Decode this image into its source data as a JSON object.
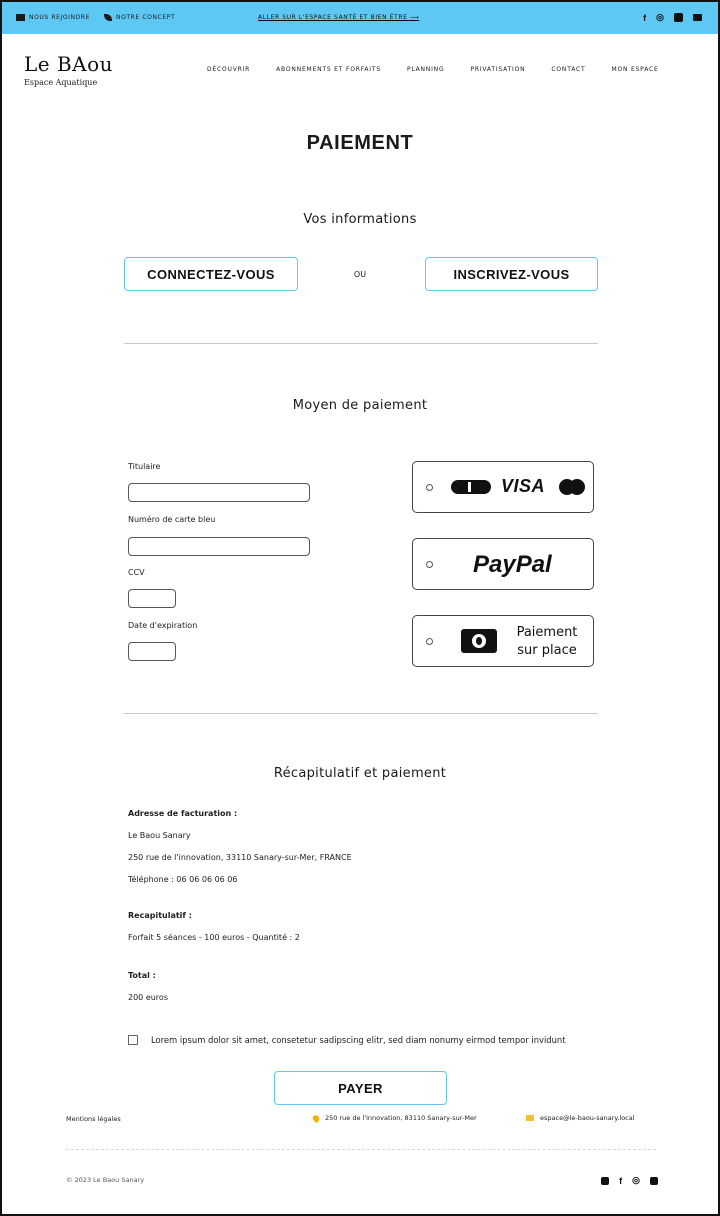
{
  "topbar": {
    "join": "NOUS REJOINDRE",
    "concept": "NOTRE CONCEPT",
    "health_link": "ALLER SUR L'ESPACE SANTÉ ET BIEN ÊTRE ⟶",
    "facebook": "f",
    "instagram": "◎"
  },
  "logo": {
    "main": "Le BAou",
    "sub": "Espace Aquatique"
  },
  "nav": [
    "DÉCOUVRIR",
    "ABONNEMENTS ET FORFAITS",
    "PLANNING",
    "PRIVATISATION",
    "CONTACT",
    "MON ESPACE"
  ],
  "page_title": "PAIEMENT",
  "info": {
    "heading": "Vos informations",
    "login": "CONNECTEZ-VOUS",
    "or": "OU",
    "signup": "INSCRIVEZ-VOUS"
  },
  "payment": {
    "heading": "Moyen de paiement",
    "holder_label": "Titulaire",
    "card_label": "Numéro de carte bleu",
    "ccv_label": "CCV",
    "expiry_label": "Date d'expiration",
    "visa": "VISA",
    "paypal": "PayPal",
    "onsite_line1": "Paiement",
    "onsite_line2": "sur place"
  },
  "summary": {
    "heading": "Récapitulatif et paiement",
    "billing_title": "Adresse de facturation :",
    "billing_name": "Le Baou Sanary",
    "billing_address": "250 rue de l'innovation, 33110 Sanary-sur-Mer, FRANCE",
    "billing_phone": "Téléphone : 06 06 06 06 06",
    "recap_title": "Recapitulatif :",
    "recap_line": "Forfait 5 séances - 100 euros - Quantité : 2",
    "total_title": "Total :",
    "total_value": "200 euros",
    "consent": "Lorem ipsum dolor sit amet, consetetur sadipscing elitr, sed diam nonumy eirmod tempor invidunt",
    "pay_button": "PAYER"
  },
  "footer": {
    "legal": "Mentions légales",
    "address": "250 rue de l'innovation, 83110 Sanary-sur-Mer",
    "email": "espace@le-baou-sanary.local",
    "copyright": "© 2023 Le Baou Sanary",
    "facebook": "f",
    "instagram": "◎"
  },
  "colors": {
    "accent": "#5ec8f5",
    "pin": "#f0b400"
  }
}
